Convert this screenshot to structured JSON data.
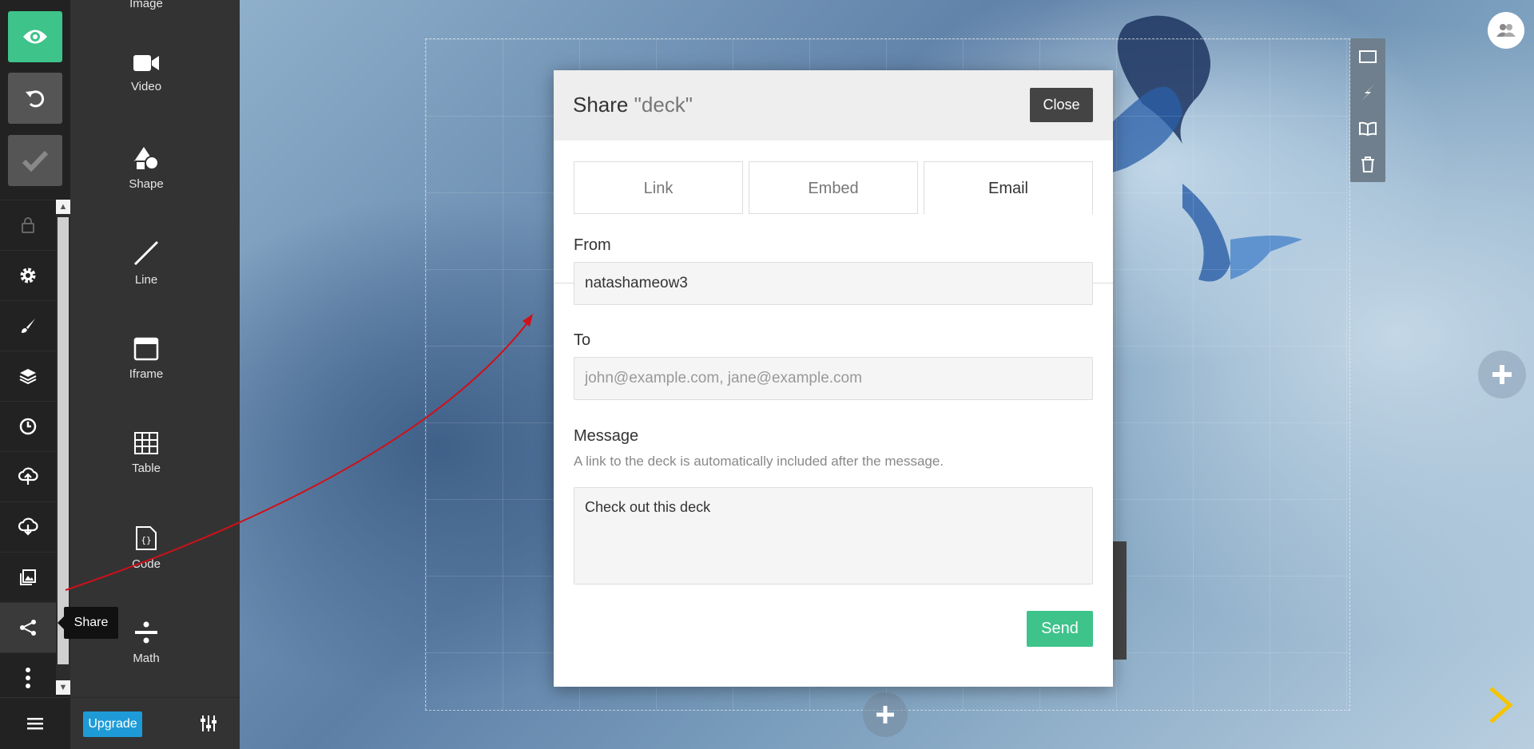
{
  "elements_panel": {
    "items": [
      {
        "label": "Image",
        "icon": "image-icon"
      },
      {
        "label": "Video",
        "icon": "video-icon"
      },
      {
        "label": "Shape",
        "icon": "shape-icon"
      },
      {
        "label": "Line",
        "icon": "line-icon"
      },
      {
        "label": "Iframe",
        "icon": "iframe-icon"
      },
      {
        "label": "Table",
        "icon": "table-icon"
      },
      {
        "label": "Code",
        "icon": "code-icon"
      },
      {
        "label": "Math",
        "icon": "math-icon"
      }
    ]
  },
  "footer": {
    "upgrade_label": "Upgrade"
  },
  "tooltip": {
    "share": "Share"
  },
  "modal": {
    "title_prefix": "Share",
    "title_deck": "\"deck\"",
    "close_label": "Close",
    "tabs": [
      {
        "label": "Link"
      },
      {
        "label": "Embed"
      },
      {
        "label": "Email",
        "active": true
      }
    ],
    "from_label": "From",
    "from_value": "natashameow3",
    "to_label": "To",
    "to_placeholder": "john@example.com, jane@example.com",
    "message_label": "Message",
    "message_hint": "A link to the deck is automatically included after the message.",
    "message_value": "Check out this deck",
    "send_label": "Send"
  },
  "colors": {
    "accent_green": "#3ec38a",
    "upgrade_blue": "#1e9bd7",
    "next_arrow": "#f5c400",
    "annotation_arrow": "#d0101a"
  }
}
